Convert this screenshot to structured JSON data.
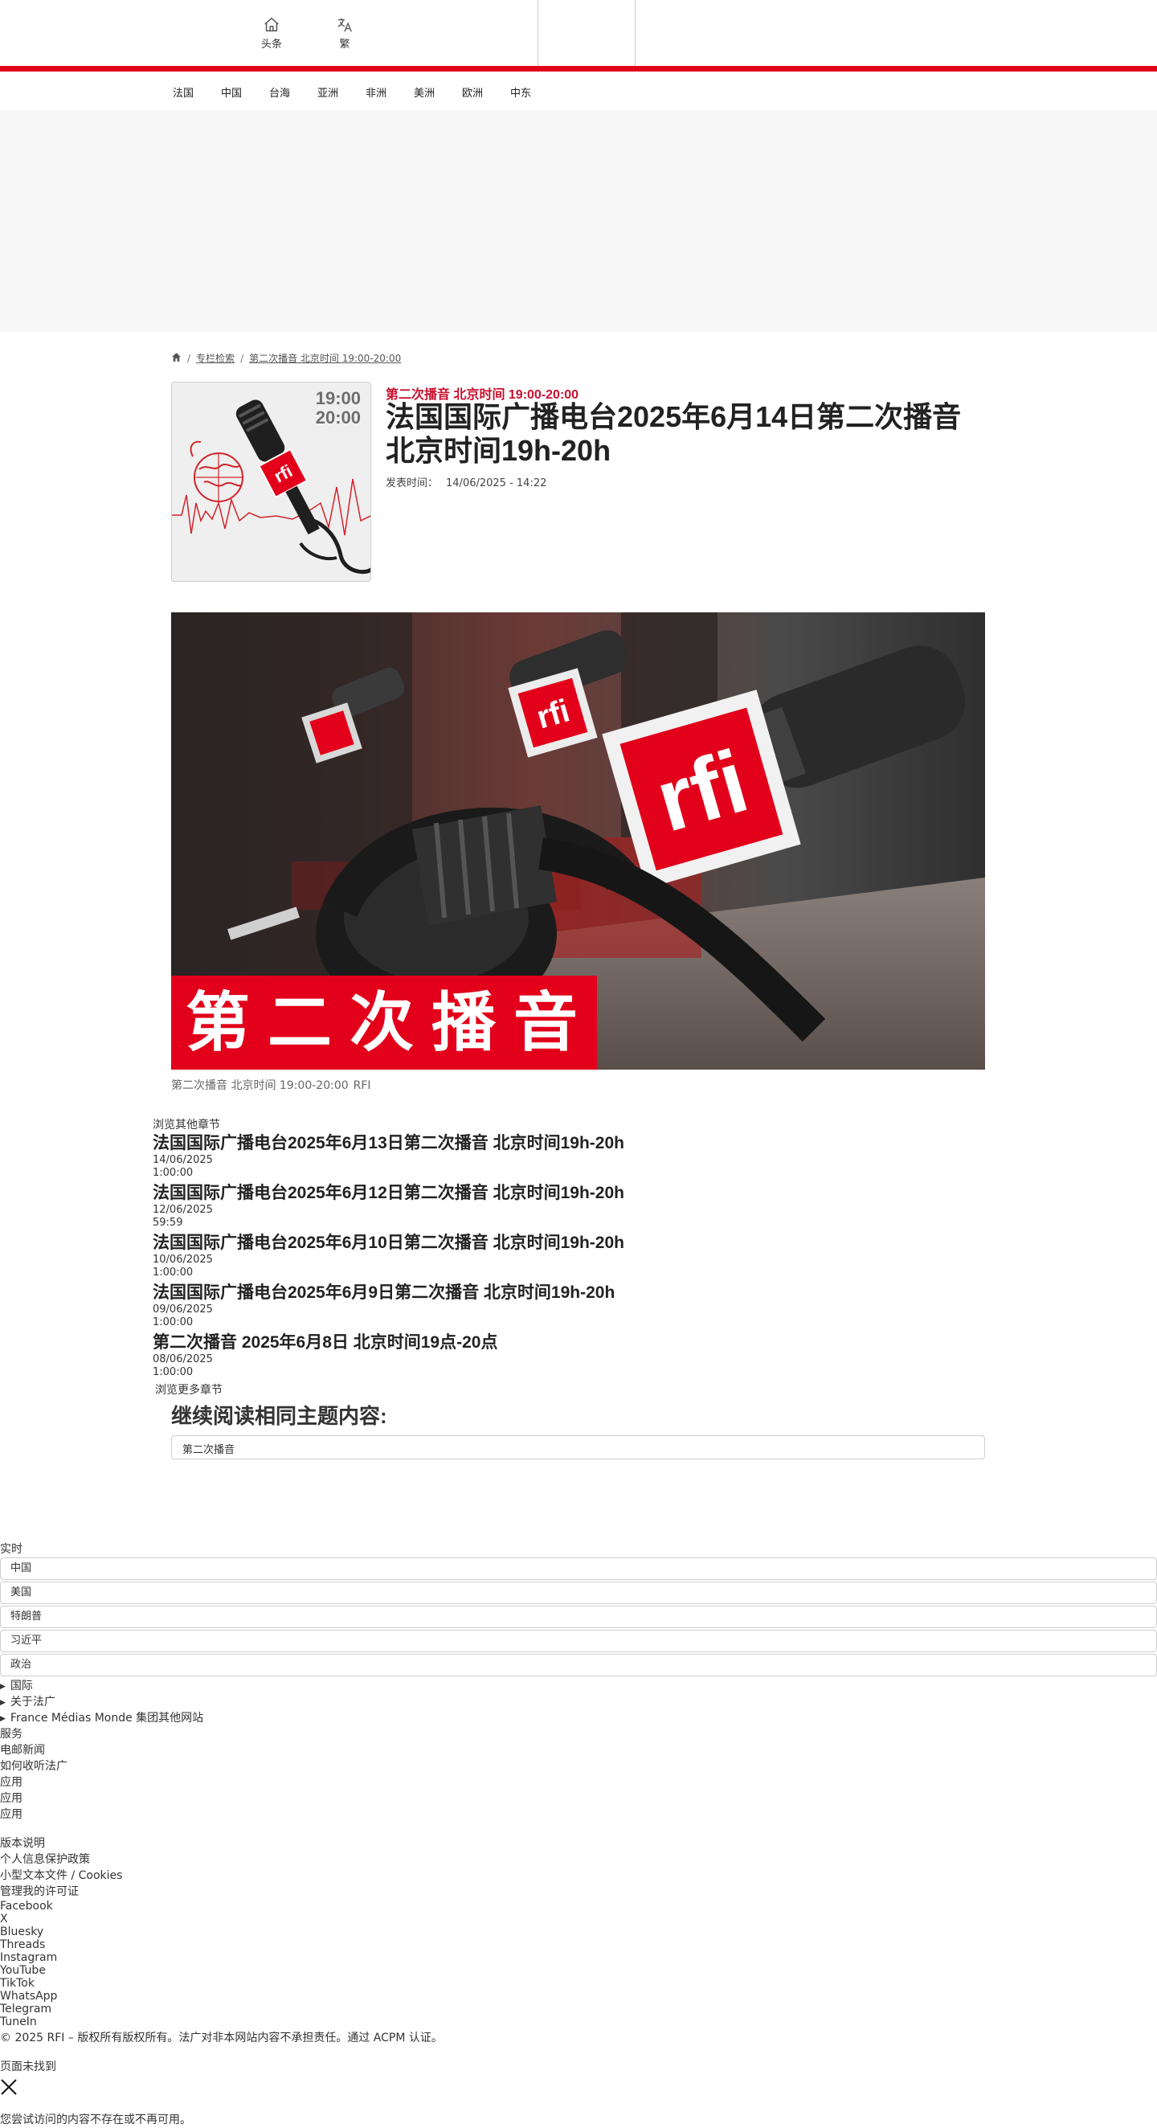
{
  "header": {
    "tools": [
      {
        "label": "头条",
        "icon": "home-icon"
      },
      {
        "label": "繁",
        "icon": "translate-icon"
      }
    ],
    "nav": [
      "法国",
      "中国",
      "台海",
      "亚洲",
      "非洲",
      "美洲",
      "欧洲",
      "中东"
    ]
  },
  "breadcrumb": {
    "home_icon": "home-icon",
    "items": [
      "专栏检索",
      "第二次播音 北京时间 19:00-20:00"
    ]
  },
  "article": {
    "cover": {
      "time_start": "19:00",
      "time_end": "20:00"
    },
    "kicker": "第二次播音 北京时间 19:00-20:00",
    "title": "法国国际广播电台2025年6月14日第二次播音 北京时间19h-20h",
    "published_label": "发表时间：",
    "published_value": "14/06/2025 - 14:22",
    "hero_banner": "第二次播音",
    "caption": "第二次播音 北京时间 19:00-20:00",
    "caption_credit": "RFI"
  },
  "episodes": {
    "heading": "浏览其他章节",
    "items": [
      {
        "title": "法国国际广播电台2025年6月13日第二次播音 北京时间19h-20h",
        "date": "14/06/2025",
        "duration": "1:00:00"
      },
      {
        "title": "法国国际广播电台2025年6月12日第二次播音 北京时间19h-20h",
        "date": "12/06/2025",
        "duration": "59:59"
      },
      {
        "title": "法国国际广播电台2025年6月10日第二次播音 北京时间19h-20h",
        "date": "10/06/2025",
        "duration": "1:00:00"
      },
      {
        "title": "法国国际广播电台2025年6月9日第二次播音 北京时间19h-20h",
        "date": "09/06/2025",
        "duration": "1:00:00"
      },
      {
        "title": "第二次播音 2025年6月8日 北京时间19点-20点",
        "date": "08/06/2025",
        "duration": "1:00:00"
      }
    ],
    "more": "浏览更多章节"
  },
  "related": {
    "title": "继续阅读相同主题内容:",
    "tag": "第二次播音"
  },
  "footer": {
    "live_heading": "实时",
    "live_tags": [
      "中国",
      "美国",
      "特朗普",
      "习近平",
      "政治"
    ],
    "sections": [
      "国际",
      "关于法广",
      "France Médias Monde 集团其他网站"
    ],
    "services_heading": "服务",
    "services": [
      "电邮新闻",
      "如何收听法广",
      "应用",
      "应用",
      "应用"
    ],
    "legal": [
      "版本说明",
      "个人信息保护政策",
      "小型文本文件 / Cookies",
      "管理我的许可证"
    ],
    "social": [
      "Facebook",
      "X",
      "Bluesky",
      "Threads",
      "Instagram",
      "YouTube",
      "TikTok",
      "WhatsApp",
      "Telegram",
      "TuneIn"
    ],
    "copyright": "© 2025 RFI – 版权所有版权所有。法广对非本网站内容不承担责任。通过 ACPM 认证。",
    "not_found_title": "页面未找到",
    "not_found_text": "您尝试访问的内容不存在或不再可用。"
  },
  "colors": {
    "brand_red": "#e2001a",
    "kicker_red": "#c8102e"
  }
}
